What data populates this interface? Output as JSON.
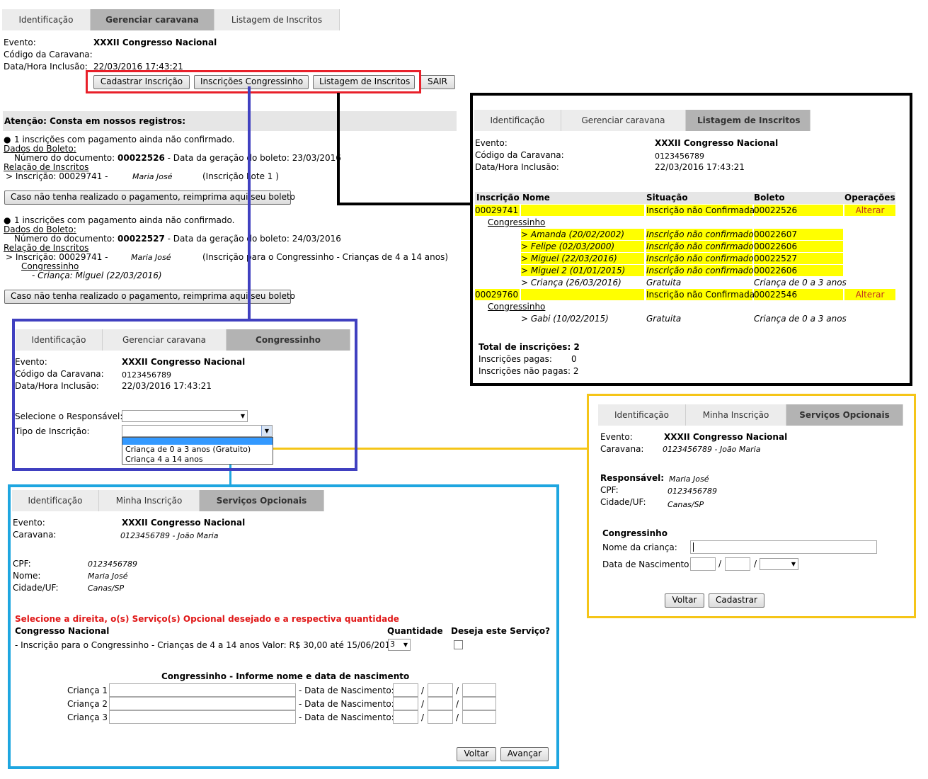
{
  "main": {
    "tabs": [
      "Identificação",
      "Gerenciar caravana",
      "Listagem de Inscritos"
    ],
    "evento_label": "Evento:",
    "evento": "XXXII Congresso Nacional",
    "codigo_label": "Código da Caravana:",
    "data_label": "Data/Hora Inclusão:",
    "data": "22/03/2016 17:43:21",
    "buttons": [
      "Cadastrar Inscrição",
      "Inscrições Congressinho",
      "Listagem de Inscritos",
      "SAIR"
    ],
    "atencao": "Atenção: Consta em nossos registros:",
    "blocks": [
      {
        "bullet": "1 inscrições com pagamento ainda não confirmado.",
        "dados": "Dados do Boleto:",
        "doc_prefix": "Número do documento: ",
        "doc_num": "00022526",
        "doc_suffix": " - Data da geração do boleto: 23/03/2016",
        "relacao": "Relação de Inscritos",
        "insc": "> Inscrição: 00029741 -",
        "nome": "Maria José",
        "tipo": "(Inscrição Lote 1 )",
        "reprint": "Caso não tenha realizado o pagamento, reimprima aqui seu boleto"
      },
      {
        "bullet": "1 inscrições com pagamento ainda não confirmado.",
        "dados": "Dados do Boleto:",
        "doc_prefix": "Número do documento: ",
        "doc_num": "00022527",
        "doc_suffix": " - Data da geração do boleto: 24/03/2016",
        "relacao": "Relação de Inscritos",
        "insc": "> Inscrição: 00029741 -",
        "nome": "Maria José",
        "tipo": "(Inscrição para o Congressinho - Crianças de 4 a 14 anos)",
        "congressinho": "Congressinho",
        "crianca": "- Criança: Miguel (22/03/2016)",
        "reprint": "Caso não tenha realizado o pagamento, reimprima aqui seu boleto"
      }
    ]
  },
  "listagem": {
    "tabs": [
      "Identificação",
      "Gerenciar caravana",
      "Listagem de Inscritos"
    ],
    "evento_label": "Evento:",
    "evento": "XXXII Congresso Nacional",
    "codigo_label": "Código da Caravana:",
    "codigo": "0123456789",
    "data_label": "Data/Hora Inclusão:",
    "data": "22/03/2016 17:43:21",
    "headers": [
      "Inscrição",
      "Nome",
      "Situação",
      "Boleto",
      "Operações"
    ],
    "rows": [
      {
        "insc": "00029741",
        "nome": "",
        "sit": "Inscrição não Confirmada",
        "bol": "00022526",
        "op": "Alterar",
        "hl": true,
        "indent": false
      },
      {
        "insc": "",
        "nome": "Congressinho",
        "sit": "",
        "bol": "",
        "op": "",
        "hl": false,
        "link": true
      },
      {
        "insc": "",
        "nome": "> Amanda (20/02/2002)",
        "sit": "Inscrição não confirmado",
        "bol": "00022607",
        "op": "",
        "hl": true,
        "child": true
      },
      {
        "insc": "",
        "nome": "> Felipe (02/03/2000)",
        "sit": "Inscrição não confirmado",
        "bol": "00022606",
        "op": "",
        "hl": true,
        "child": true
      },
      {
        "insc": "",
        "nome": "> Miguel (22/03/2016)",
        "sit": "Inscrição não confirmado",
        "bol": "00022527",
        "op": "",
        "hl": true,
        "child": true
      },
      {
        "insc": "",
        "nome": "> Miguel 2 (01/01/2015)",
        "sit": "Inscrição não confirmado",
        "bol": "00022606",
        "op": "",
        "hl": true,
        "child": true
      },
      {
        "insc": "",
        "nome": ">        Criança (26/03/2016)",
        "sit": "Gratuita",
        "bol": "Criança de 0 a 3 anos",
        "op": "",
        "hl": false,
        "child": true
      },
      {
        "insc": "00029760",
        "nome": "",
        "sit": "Inscrição não Confirmada",
        "bol": "00022546",
        "op": "Alterar",
        "hl": true
      },
      {
        "insc": "",
        "nome": "Congressinho",
        "sit": "",
        "bol": "",
        "op": "",
        "hl": false,
        "link": true
      },
      {
        "insc": "",
        "nome": "> Gabi (10/02/2015)",
        "sit": "Gratuita",
        "bol": "Criança de 0 a 3 anos",
        "op": "",
        "hl": false,
        "child": true
      }
    ],
    "total_label": "Total de inscrições:",
    "total": "2",
    "pagas_label": "Inscrições pagas:",
    "pagas": "0",
    "naopagas_label": "Inscrições não pagas:",
    "naopagas": "2"
  },
  "congressinho": {
    "tabs": [
      "Identificação",
      "Gerenciar caravana",
      "Congressinho"
    ],
    "evento_label": "Evento:",
    "evento": "XXXII Congresso Nacional",
    "codigo_label": "Código da Caravana:",
    "codigo": "0123456789",
    "data_label": "Data/Hora Inclusão:",
    "data": "22/03/2016 17:43:21",
    "responsavel_label": "Selecione o Responsável:",
    "tipo_label": "Tipo de Inscrição:",
    "options": [
      "Criança de 0 a 3 anos (Gratuito)",
      "Criança 4 a 14 anos"
    ]
  },
  "servicos_blue": {
    "tabs": [
      "Identificação",
      "Minha Inscrição",
      "Serviços Opcionais"
    ],
    "evento_label": "Evento:",
    "evento": "XXXII Congresso Nacional",
    "caravana_label": "Caravana:",
    "caravana": "0123456789 - João Maria",
    "cpf_label": "CPF:",
    "cpf": "0123456789",
    "nome_label": "Nome:",
    "nome": "Maria José",
    "cidade_label": "Cidade/UF:",
    "cidade": "Canas/SP",
    "instrucao": "Selecione a direita, o(s) Serviço(s) Opcional desejado e a respectiva quantidade",
    "col_servico": "Congresso Nacional",
    "col_qtd": "Quantidade",
    "col_deseja": "Deseja este Serviço?",
    "servico": "- Inscrição para o Congressinho - Crianças de 4 a 14 anos Valor: R$ 30,00 até 15/06/2016",
    "qtd": "3",
    "informe": "Congressinho - Informe nome e data de nascimento",
    "criancas": [
      "Criança 1",
      "Criança 2",
      "Criança 3"
    ],
    "nasc_label": "- Data de Nascimento:",
    "voltar": "Voltar",
    "avancar": "Avançar"
  },
  "servicos_yellow": {
    "tabs": [
      "Identificação",
      "Minha Inscrição",
      "Serviços Opcionais"
    ],
    "evento_label": "Evento:",
    "evento": "XXXII Congresso Nacional",
    "caravana_label": "Caravana:",
    "caravana": "0123456789 - João Maria",
    "responsavel_label": "Responsável:",
    "responsavel": "Maria José",
    "cpf_label": "CPF:",
    "cpf": "0123456789",
    "cidade_label": "Cidade/UF:",
    "cidade": "Canas/SP",
    "congressinho": "Congressinho",
    "nome_label": "Nome da criança:",
    "nasc_label": "Data de Nascimento:",
    "voltar": "Voltar",
    "cadastrar": "Cadastrar"
  },
  "colors": {
    "red": "#e8202a",
    "black": "#000000",
    "indigo": "#4040c0",
    "cyan": "#1ea6e0",
    "yellow": "#f5c518",
    "highlight": "#ffff00"
  }
}
